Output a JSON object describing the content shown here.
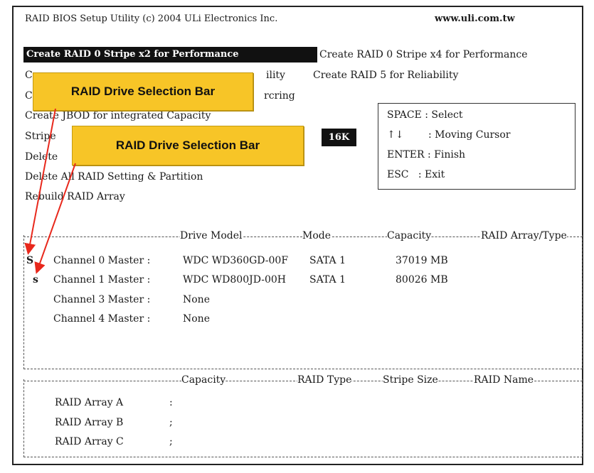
{
  "title": "RAID BIOS Setup Utility (c) 2004 ULi Electronics Inc.",
  "website": "www.uli.com.tw",
  "menu": {
    "selected": "Create RAID 0 Stripe x2 for Performance",
    "item_stripe_x4": "Create RAID 0 Stripe x4 for Performance",
    "item_raid1_partial_a": "C",
    "item_raid1_partial_b": "ility",
    "item_raid5": "Create RAID 5 for Reliability",
    "item_mirror_partial_a": "C",
    "item_mirror_partial_b": "rcring",
    "item_jbod": "Create JBOD for integrated Capacity",
    "item_stripe_partial": "Stripe",
    "item_delete_partial": "Delete",
    "item_delete_all": "Delete All RAID Setting & Partition",
    "item_rebuild": "Rebuild RAID Array",
    "stripe_value": "16K"
  },
  "help": {
    "space": "SPACE : Select",
    "arrows_symbol": "↑↓",
    "arrows": ": Moving Cursor",
    "enter": "ENTER : Finish",
    "esc": "ESC   : Exit"
  },
  "drive_panel": {
    "headers": {
      "drive_model": "Drive Model",
      "mode": "Mode",
      "capacity": "Capacity",
      "raid_array_type": "RAID Array/Type"
    },
    "drives": [
      {
        "sel": "S",
        "channel": "Channel 0 Master :",
        "model": "WDC WD360GD-00F",
        "mode": "SATA 1",
        "capacity": "37019 MB"
      },
      {
        "sel": "s",
        "channel": "Channel 1 Master :",
        "model": "WDC WD800JD-00H",
        "mode": "SATA 1",
        "capacity": "80026 MB"
      },
      {
        "sel": "",
        "channel": "Channel 3 Master :",
        "model": "None",
        "mode": "",
        "capacity": ""
      },
      {
        "sel": "",
        "channel": "Channel 4 Master :",
        "model": "None",
        "mode": "",
        "capacity": ""
      }
    ]
  },
  "array_panel": {
    "headers": {
      "capacity": "Capacity",
      "raid_type": "RAID Type",
      "stripe_size": "Stripe Size",
      "raid_name": "RAID Name"
    },
    "arrays": [
      {
        "name": "RAID Array A",
        "sep": ":"
      },
      {
        "name": "RAID Array B",
        "sep": ";"
      },
      {
        "name": "RAID Array C",
        "sep": ";"
      }
    ]
  },
  "callouts": {
    "top": "RAID Drive Selection Bar",
    "bottom": "RAID Drive Selection Bar"
  },
  "colors": {
    "callout_fill": "#f7c527",
    "arrow": "#e8281c",
    "highlight_bg": "#111111"
  }
}
